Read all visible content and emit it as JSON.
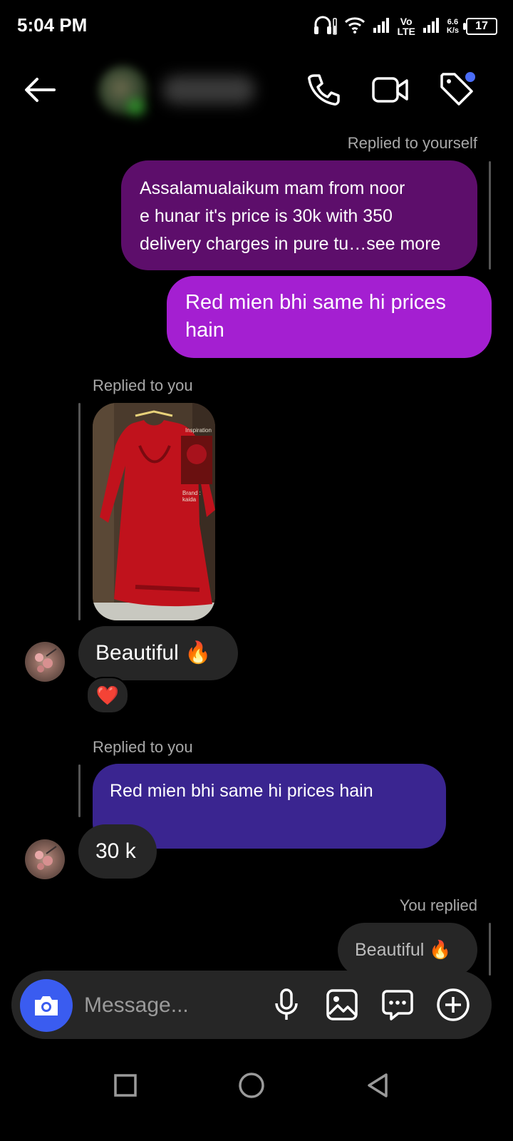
{
  "status_bar": {
    "time": "5:04 PM",
    "volte_top": "Vo",
    "volte_bottom": "LTE",
    "speed_value": "6.6",
    "speed_unit": "K/s",
    "battery": "17",
    "icons": [
      "headphones-icon",
      "wifi-icon",
      "signal-icon",
      "signal-icon",
      "battery-icon"
    ]
  },
  "header": {
    "icons": [
      "back-arrow-icon",
      "phone-icon",
      "video-icon",
      "tag-icon"
    ],
    "accent_dot_color": "#4a6cf7"
  },
  "messages": {
    "m1": {
      "meta": "Replied to yourself",
      "line1": "Assalamualaikum mam from noor",
      "line2": "e hunar it's price is 30k with 350",
      "line3": "delivery charges in pure tu…see more"
    },
    "m2": {
      "text": "Red mien bhi same hi prices hain"
    },
    "m3": {
      "meta": "Replied to you",
      "image_caption_1": "Inspiration",
      "image_caption_2": "Brand : kaida",
      "text": "Beautiful 🔥",
      "reaction": "❤️"
    },
    "m4": {
      "meta": "Replied to you",
      "quoted": "Red mien bhi same hi prices hain",
      "text": "30 k"
    },
    "m5": {
      "meta": "You replied",
      "quoted": "Beautiful 🔥"
    }
  },
  "composer": {
    "placeholder": "Message...",
    "icons": [
      "camera-icon",
      "microphone-icon",
      "gallery-icon",
      "sticker-icon",
      "add-icon"
    ]
  },
  "nav_bar": {
    "icons": [
      "recents-icon",
      "home-icon",
      "back-icon"
    ]
  },
  "colors": {
    "background": "#000000",
    "sent_purple": "#5d0e6b",
    "sent_magenta": "#a41fd1",
    "received": "#262626",
    "quoted_blue": "#3a2590",
    "camera_button": "#3a5cf0"
  }
}
